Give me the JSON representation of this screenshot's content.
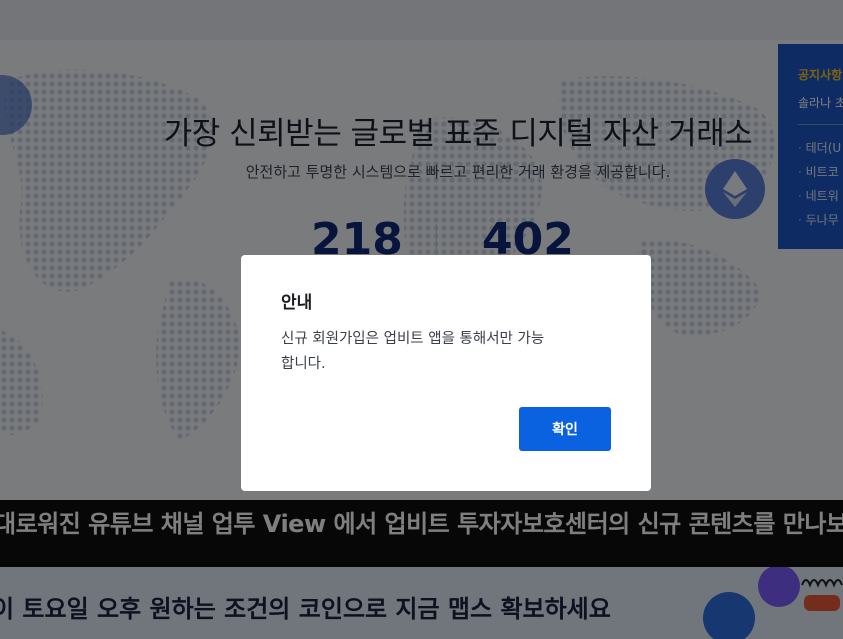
{
  "hero": {
    "title": "가장 신뢰받는 글로벌 표준 디지털 자산 거래소",
    "subtitle": "안전하고 투명한 시스템으로 빠르고 편리한 거래 환경을 제공합니다.",
    "stat_a": "218",
    "stat_b": "402"
  },
  "notice": {
    "title": "공지사항",
    "first": "솔라나 초",
    "items": [
      "테더(U",
      "비트코",
      "네트워",
      "두나무"
    ]
  },
  "marquee": {
    "text": "대로워진 유튜브 채널 업투 View 에서 업비트 투자자보호센터의 신규 콘텐츠를 만나보세요"
  },
  "bottom_banner": {
    "text": "이 토요일 오후 원하는 조건의 코인으로 지금 맵스 확보하세요"
  },
  "dialog": {
    "title": "안내",
    "message": "신규 회원가입은 업비트 앱을 통해서만 가능합니다.",
    "confirm_label": "확인"
  },
  "colors": {
    "accent": "#0a62e0",
    "overlay": "rgba(0,0,0,0.5)",
    "notice_panel": "#1c58c6",
    "stat_color": "#0f2a78"
  },
  "icons": {
    "eth_coin": "ethereum-icon",
    "globe": "globe-icon"
  }
}
